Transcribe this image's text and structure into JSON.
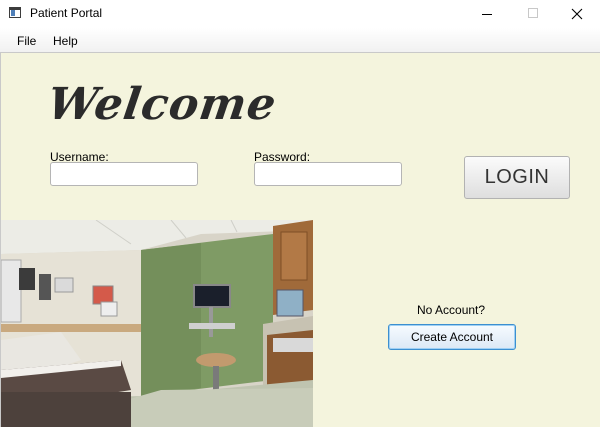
{
  "window": {
    "title": "Patient Portal",
    "icon": "application-window-icon"
  },
  "menu": {
    "file": "File",
    "help": "Help"
  },
  "login": {
    "welcome": "Welcome",
    "username_label": "Username:",
    "username_value": "",
    "password_label": "Password:",
    "password_value": "",
    "login_button": "LOGIN"
  },
  "signup": {
    "prompt": "No Account?",
    "create_button": "Create Account"
  },
  "colors": {
    "content_background": "#f4f4dd",
    "create_button_border": "#3c8fd0",
    "exam_room_wall": "#7f9b65"
  }
}
